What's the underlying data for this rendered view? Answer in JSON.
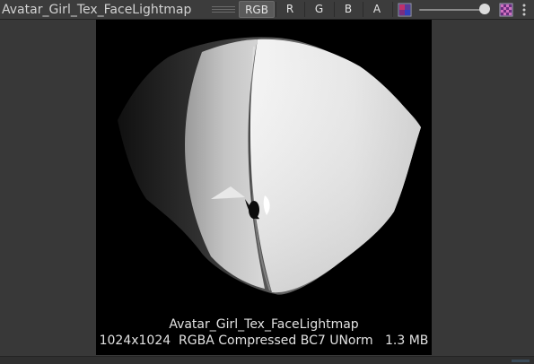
{
  "toolbar": {
    "title": "Avatar_Girl_Tex_FaceLightmap",
    "channels": [
      {
        "label": "RGB",
        "active": true
      },
      {
        "label": "R",
        "active": false
      },
      {
        "label": "G",
        "active": false
      },
      {
        "label": "B",
        "active": false
      },
      {
        "label": "A",
        "active": false
      }
    ],
    "mip_slider_value": 0.96,
    "icons": [
      "color-mode-icon",
      "checker-background-icon",
      "more-options-icon"
    ]
  },
  "preview": {
    "texture_name": "Avatar_Girl_Tex_FaceLightmap",
    "details": "1024x1024  RGBA Compressed BC7 UNorm   1.3 MB"
  },
  "colors": {
    "toolbar_bg": "#3c3c3c",
    "panel_bg": "#383838",
    "active_button": "#5a5a5a",
    "text": "#e2e2e2"
  }
}
